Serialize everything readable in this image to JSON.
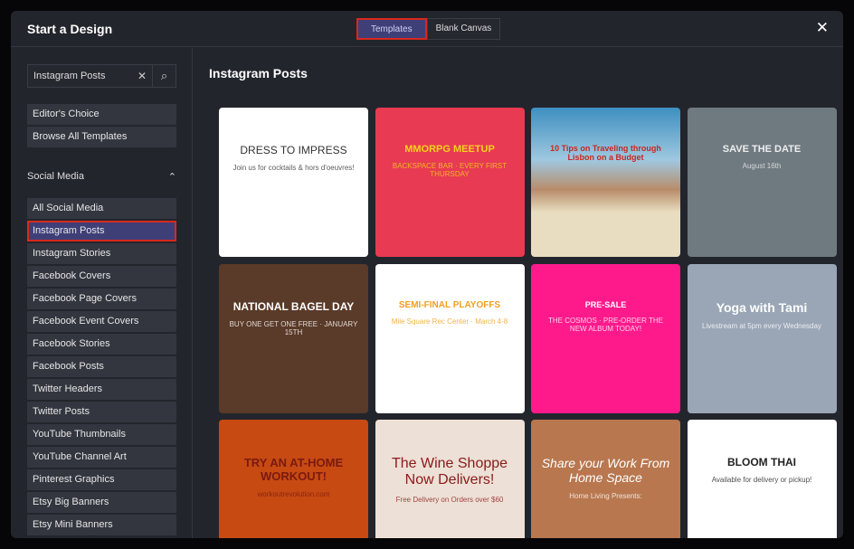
{
  "header": {
    "title": "Start a Design",
    "tabs": [
      "Templates",
      "Blank Canvas"
    ],
    "close": "✕"
  },
  "search": {
    "value": "Instagram Posts",
    "clear": "✕",
    "icon": "⌕"
  },
  "sidebar": {
    "top_items": [
      "Editor's Choice",
      "Browse All Templates"
    ],
    "section": "Social Media",
    "section_chevron": "⌃",
    "items": [
      "All Social Media",
      "Instagram Posts",
      "Instagram Stories",
      "Facebook Covers",
      "Facebook Page Covers",
      "Facebook Event Covers",
      "Facebook Stories",
      "Facebook Posts",
      "Twitter Headers",
      "Twitter Posts",
      "YouTube Thumbnails",
      "YouTube Channel Art",
      "Pinterest Graphics",
      "Etsy Big Banners",
      "Etsy Mini Banners"
    ]
  },
  "main": {
    "title": "Instagram Posts",
    "templates": [
      {
        "title": "DRESS TO IMPRESS",
        "sub": "Join us for cocktails & hors d'oeuvres!"
      },
      {
        "title": "MMORPG MEETUP",
        "sub": "BACKSPACE BAR · EVERY FIRST THURSDAY"
      },
      {
        "title": "10 Tips on Traveling through Lisbon on a Budget",
        "sub": ""
      },
      {
        "title": "SAVE THE DATE",
        "sub": "August 16th"
      },
      {
        "title": "NATIONAL BAGEL DAY",
        "sub": "BUY ONE GET ONE FREE · JANUARY 15TH"
      },
      {
        "title": "SEMI-FINAL PLAYOFFS",
        "sub": "Mile Square Rec Center · March 4-8"
      },
      {
        "title": "PRE-SALE",
        "sub": "THE COSMOS · PRE-ORDER THE NEW ALBUM TODAY!"
      },
      {
        "title": "Yoga with Tami",
        "sub": "Livestream at 5pm every Wednesday"
      },
      {
        "title": "TRY AN AT-HOME WORKOUT!",
        "sub": "workoutrevolution.com"
      },
      {
        "title": "The Wine Shoppe Now Delivers!",
        "sub": "Free Delivery on Orders over $60"
      },
      {
        "title": "Share your Work From Home Space",
        "sub": "Home Living Presents:"
      },
      {
        "title": "BLOOM THAI",
        "sub": "Available for delivery or pickup!"
      }
    ]
  }
}
